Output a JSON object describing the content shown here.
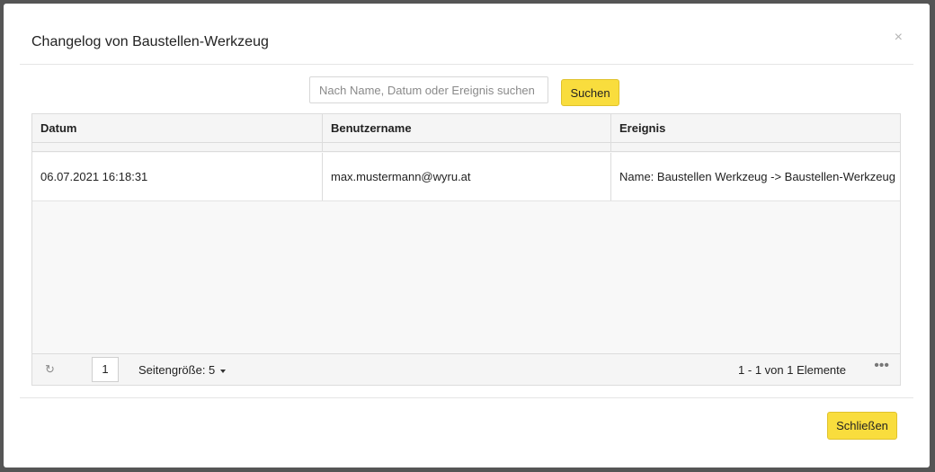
{
  "dialog": {
    "title": "Changelog von Baustellen-Werkzeug",
    "close_symbol": "×",
    "close_button_label": "Schließen"
  },
  "search": {
    "placeholder": "Nach Name, Datum oder Ereignis suchen",
    "value": "",
    "button_label": "Suchen"
  },
  "grid": {
    "columns": [
      "Datum",
      "Benutzername",
      "Ereignis"
    ],
    "rows": [
      {
        "datum": "06.07.2021 16:18:31",
        "benutzername": "max.mustermann@wyru.at",
        "ereignis": "Name: Baustellen Werkzeug -> Baustellen-Werkzeug"
      }
    ]
  },
  "pager": {
    "current_page": "1",
    "page_size_label": "Seitengröße: 5",
    "count_text": "1 - 1 von 1 Elemente",
    "refresh_icon": "↻",
    "more_icon": "•••"
  },
  "colors": {
    "accent": "#f9dd3d",
    "backdrop": "#555555"
  }
}
